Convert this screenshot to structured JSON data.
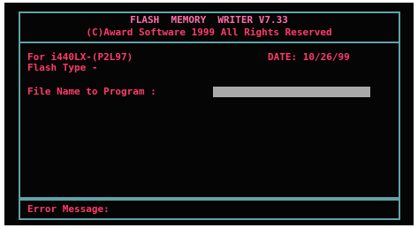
{
  "header": {
    "title": "FLASH  MEMORY  WRITER V7.33",
    "copyright": "(C)Award Software 1999 All Rights Reserved"
  },
  "info": {
    "board": "For i440LX-(P2L97)",
    "flash_type": "Flash Type -",
    "date": "DATE: 10/26/99"
  },
  "prompt": {
    "label": "File Name to Program :",
    "value": ""
  },
  "footer": {
    "error_label": "Error Message:"
  },
  "colors": {
    "background": "#050505",
    "frame": "#5fa3a8",
    "text": "#ff3b6a",
    "input_field": "#a9a9a9"
  }
}
